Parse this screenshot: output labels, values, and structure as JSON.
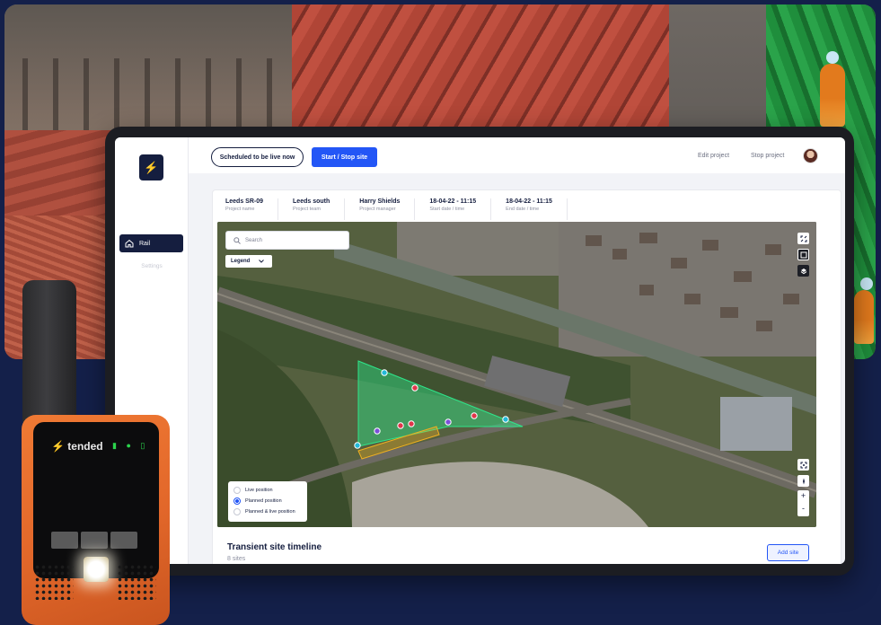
{
  "app": {
    "logo_glyph": "⚡",
    "sidebar": {
      "items": [
        {
          "label": "Rail",
          "icon": "home-icon",
          "active": true
        },
        {
          "label": "Settings",
          "active": false
        }
      ]
    },
    "topbar": {
      "status_button": "Scheduled to be live now",
      "primary_button": "Start / Stop site",
      "edit_link": "Edit project",
      "stop_link": "Stop project"
    },
    "project": {
      "fields": [
        {
          "value": "Leeds SR-09",
          "label": "Project name"
        },
        {
          "value": "Leeds south",
          "label": "Project team"
        },
        {
          "value": "Harry Shields",
          "label": "Project manager"
        },
        {
          "value": "18-04-22 - 11:15",
          "label": "Start date / time"
        },
        {
          "value": "18-04-22 - 11:15",
          "label": "End date / time"
        }
      ]
    },
    "map": {
      "search_placeholder": "Search",
      "legend_dropdown": "Legend",
      "legend_options": [
        {
          "label": "Live position",
          "selected": false
        },
        {
          "label": "Planned position",
          "selected": true
        },
        {
          "label": "Planned & live position",
          "selected": false
        }
      ],
      "zoom_in": "+",
      "zoom_out": "-",
      "zone_color": "#2ee68a",
      "marker_colors": {
        "live": "#23b9d9",
        "planned": "#e0354a",
        "both": "#7b4fd8"
      }
    },
    "timeline": {
      "title": "Transient site timeline",
      "count": "8 sites",
      "add_button": "Add site"
    }
  },
  "device": {
    "brand": "tended",
    "status_icons": "▮ ● ▯"
  },
  "colors": {
    "navy": "#151e3f",
    "accent_blue": "#2356f6",
    "device_orange": "#e2672a"
  }
}
